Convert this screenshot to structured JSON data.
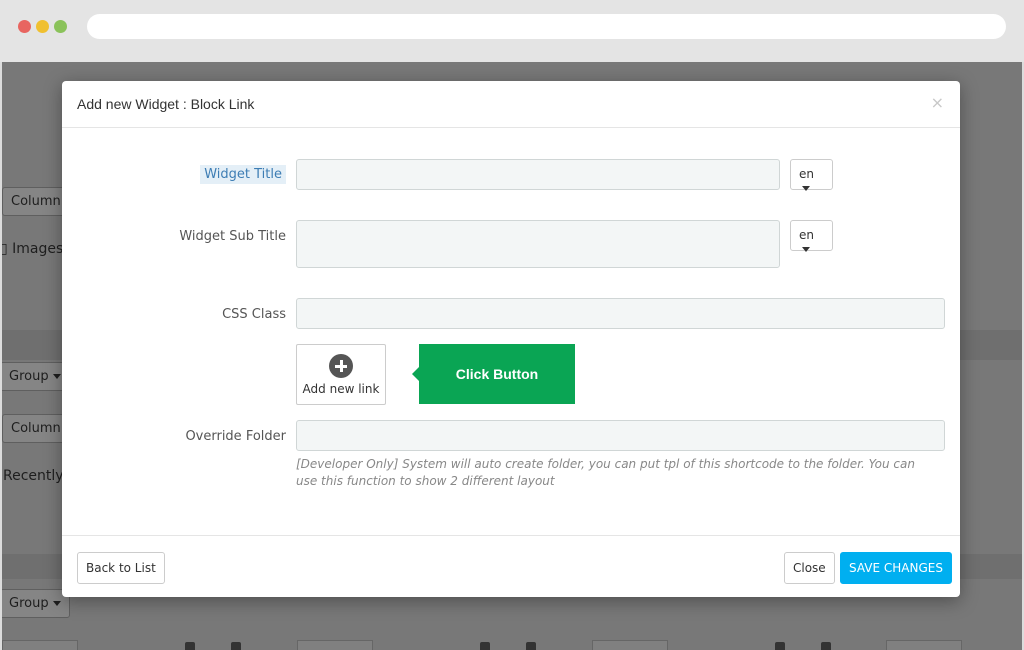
{
  "modal": {
    "title": "Add new Widget : Block Link",
    "close_icon": "×",
    "fields": {
      "widget_title_label": "Widget Title",
      "widget_title_value": "",
      "widget_title_lang": "en",
      "widget_subtitle_label": "Widget Sub Title",
      "widget_subtitle_value": "",
      "widget_subtitle_lang": "en",
      "css_class_label": "CSS Class",
      "css_class_value": "",
      "override_folder_label": "Override Folder",
      "override_folder_value": ""
    },
    "add_link_label": "Add new link",
    "callout_text": "Click Button",
    "help_text": "[Developer Only] System will auto create folder, you can put tpl of this shortcode to the folder. You can use this function to show 2 different layout",
    "footer": {
      "back_label": "Back to List",
      "close_label": "Close",
      "save_label": "SAVE CHANGES"
    }
  },
  "background": {
    "column_1": "Column",
    "images": "Images",
    "group_1": "Group",
    "column_2": "Column",
    "recently": "Recently",
    "group_2": "Group"
  },
  "colors": {
    "primary": "#00aff0",
    "callout": "#0aa554",
    "overlay": "#787878"
  }
}
